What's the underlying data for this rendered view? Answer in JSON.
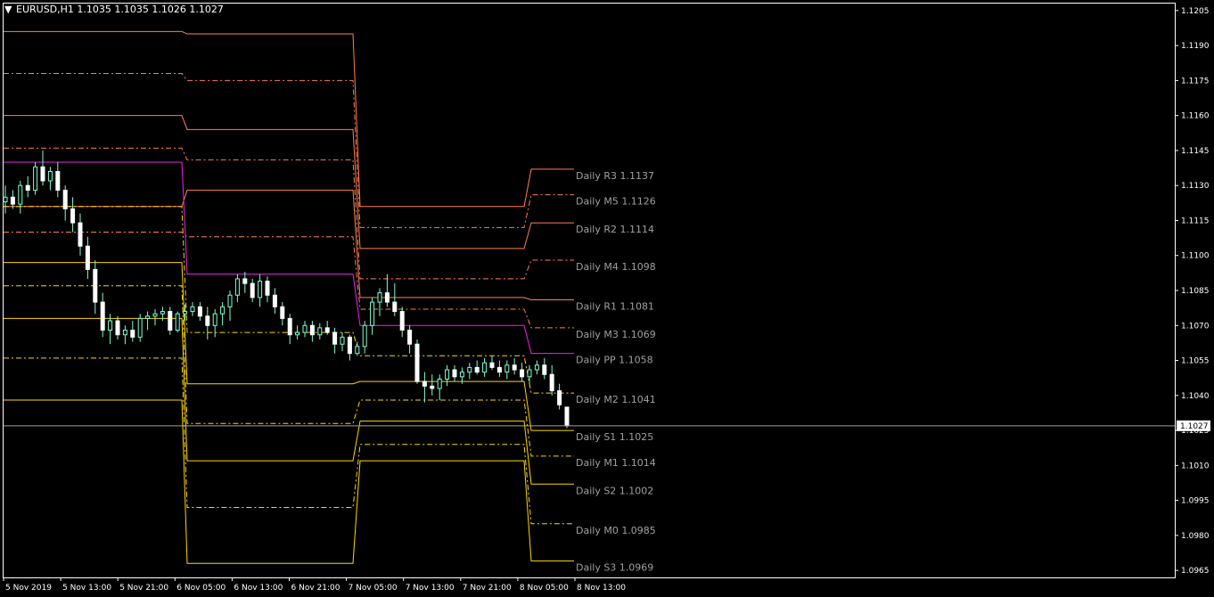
{
  "header": {
    "symbol_text": "EURUSD,H1  1.1035 1.1035 1.1026 1.1027",
    "dropdown_glyph": "▼"
  },
  "colors": {
    "background": "#000000",
    "axis": "#ffffff",
    "bull": "#7fffd4",
    "bear": "#ffffff",
    "wick": "#7fffd4",
    "resistance": "#ff7f50",
    "pivot": "#ee22ee",
    "support": "#ffd700",
    "mid": "#ffffff",
    "label": "#a0a0a0"
  },
  "chart_data": {
    "type": "candlestick",
    "symbol": "EURUSD",
    "timeframe": "H1",
    "last_price": 1.1027,
    "ylim": [
      1.0962,
      1.1208
    ],
    "y_ticks": [
      "1.1205",
      "1.1190",
      "1.1175",
      "1.1160",
      "1.1145",
      "1.1130",
      "1.1115",
      "1.1100",
      "1.1085",
      "1.1070",
      "1.1055",
      "1.1040",
      "1.1025",
      "1.1010",
      "1.0995",
      "1.0980",
      "1.0965"
    ],
    "x_ticks": [
      "5 Nov 2019",
      "5 Nov 13:00",
      "5 Nov 21:00",
      "6 Nov 05:00",
      "6 Nov 13:00",
      "6 Nov 21:00",
      "7 Nov 05:00",
      "7 Nov 13:00",
      "7 Nov 21:00",
      "8 Nov 05:00",
      "8 Nov 13:00"
    ],
    "current_price_label": "1.1027",
    "candles": [
      [
        1.1123,
        1.113,
        1.1118,
        1.1125
      ],
      [
        1.1125,
        1.1128,
        1.112,
        1.1122
      ],
      [
        1.1122,
        1.1132,
        1.1118,
        1.113
      ],
      [
        1.113,
        1.1134,
        1.1125,
        1.1128
      ],
      [
        1.1128,
        1.114,
        1.1126,
        1.1138
      ],
      [
        1.1138,
        1.1145,
        1.113,
        1.1132
      ],
      [
        1.1132,
        1.1138,
        1.1128,
        1.1136
      ],
      [
        1.1136,
        1.114,
        1.1125,
        1.1128
      ],
      [
        1.1128,
        1.113,
        1.1115,
        1.112
      ],
      [
        1.112,
        1.1125,
        1.111,
        1.1114
      ],
      [
        1.1114,
        1.1118,
        1.11,
        1.1104
      ],
      [
        1.1104,
        1.1108,
        1.109,
        1.1094
      ],
      [
        1.1094,
        1.1098,
        1.1075,
        1.108
      ],
      [
        1.108,
        1.1084,
        1.1065,
        1.1068
      ],
      [
        1.1068,
        1.1075,
        1.1062,
        1.1072
      ],
      [
        1.1072,
        1.1074,
        1.1064,
        1.1066
      ],
      [
        1.1066,
        1.107,
        1.1062,
        1.1068
      ],
      [
        1.1068,
        1.1072,
        1.1063,
        1.1065
      ],
      [
        1.1065,
        1.1075,
        1.1063,
        1.1073
      ],
      [
        1.1073,
        1.1076,
        1.1068,
        1.1074
      ],
      [
        1.1074,
        1.1077,
        1.107,
        1.1075
      ],
      [
        1.1075,
        1.1078,
        1.1072,
        1.1076
      ],
      [
        1.1076,
        1.1078,
        1.1066,
        1.1068
      ],
      [
        1.1068,
        1.1076,
        1.1067,
        1.1075
      ],
      [
        1.1075,
        1.1079,
        1.1072,
        1.1076
      ],
      [
        1.1076,
        1.108,
        1.1074,
        1.1078
      ],
      [
        1.1078,
        1.108,
        1.1072,
        1.1074
      ],
      [
        1.1074,
        1.1078,
        1.1064,
        1.107
      ],
      [
        1.107,
        1.1077,
        1.1065,
        1.1075
      ],
      [
        1.1075,
        1.108,
        1.107,
        1.1078
      ],
      [
        1.1078,
        1.1085,
        1.1072,
        1.1083
      ],
      [
        1.1083,
        1.1092,
        1.108,
        1.109
      ],
      [
        1.109,
        1.1093,
        1.1084,
        1.1088
      ],
      [
        1.1088,
        1.109,
        1.108,
        1.1082
      ],
      [
        1.1082,
        1.1092,
        1.1078,
        1.1089
      ],
      [
        1.1089,
        1.1091,
        1.108,
        1.1083
      ],
      [
        1.1083,
        1.1086,
        1.1075,
        1.1078
      ],
      [
        1.1078,
        1.108,
        1.107,
        1.1073
      ],
      [
        1.1073,
        1.1075,
        1.1062,
        1.1066
      ],
      [
        1.1066,
        1.107,
        1.1064,
        1.1067
      ],
      [
        1.1067,
        1.1072,
        1.1065,
        1.107
      ],
      [
        1.107,
        1.1072,
        1.1063,
        1.1066
      ],
      [
        1.1066,
        1.1071,
        1.1064,
        1.1069
      ],
      [
        1.1069,
        1.1072,
        1.1066,
        1.1067
      ],
      [
        1.1067,
        1.1069,
        1.1058,
        1.1062
      ],
      [
        1.1062,
        1.1067,
        1.1059,
        1.1065
      ],
      [
        1.1065,
        1.1066,
        1.1055,
        1.1058
      ],
      [
        1.1058,
        1.1063,
        1.1057,
        1.1061
      ],
      [
        1.1061,
        1.1072,
        1.1058,
        1.107
      ],
      [
        1.107,
        1.1082,
        1.1066,
        1.108
      ],
      [
        1.108,
        1.1086,
        1.1074,
        1.1084
      ],
      [
        1.1084,
        1.1092,
        1.1078,
        1.108
      ],
      [
        1.108,
        1.1088,
        1.1074,
        1.1076
      ],
      [
        1.1076,
        1.1078,
        1.1065,
        1.1068
      ],
      [
        1.1068,
        1.107,
        1.1058,
        1.1062
      ],
      [
        1.1062,
        1.1064,
        1.1045,
        1.1046
      ],
      [
        1.1046,
        1.105,
        1.1037,
        1.1044
      ],
      [
        1.1044,
        1.1049,
        1.104,
        1.1043
      ],
      [
        1.1043,
        1.1049,
        1.1038,
        1.1047
      ],
      [
        1.1047,
        1.1053,
        1.1044,
        1.1051
      ],
      [
        1.1051,
        1.1053,
        1.1046,
        1.1048
      ],
      [
        1.1048,
        1.1052,
        1.1045,
        1.105
      ],
      [
        1.105,
        1.1054,
        1.1047,
        1.1052
      ],
      [
        1.1052,
        1.1055,
        1.1049,
        1.105
      ],
      [
        1.105,
        1.1056,
        1.1048,
        1.1054
      ],
      [
        1.1054,
        1.1057,
        1.1051,
        1.1052
      ],
      [
        1.1052,
        1.1055,
        1.1048,
        1.105
      ],
      [
        1.105,
        1.1055,
        1.1047,
        1.1053
      ],
      [
        1.1053,
        1.1056,
        1.1049,
        1.1051
      ],
      [
        1.1051,
        1.1054,
        1.1046,
        1.1048
      ],
      [
        1.1048,
        1.1053,
        1.1045,
        1.1051
      ],
      [
        1.1051,
        1.1055,
        1.1049,
        1.1053
      ],
      [
        1.1053,
        1.1056,
        1.1047,
        1.1049
      ],
      [
        1.1049,
        1.1053,
        1.104,
        1.1042
      ],
      [
        1.1042,
        1.1045,
        1.1034,
        1.1036
      ],
      [
        1.1035,
        1.1035,
        1.1026,
        1.1027
      ]
    ],
    "pivot_levels": [
      {
        "name": "R3",
        "kind": "resistance",
        "dash": false,
        "values": [
          1.1196,
          1.1195,
          1.1121,
          1.1137
        ]
      },
      {
        "name": "M5",
        "kind": "resistance",
        "dash": true,
        "values": [
          1.1178,
          1.1175,
          1.1112,
          1.1126
        ]
      },
      {
        "name": "R2",
        "kind": "resistance",
        "dash": false,
        "values": [
          1.116,
          1.1154,
          1.1103,
          1.1114
        ]
      },
      {
        "name": "M4",
        "kind": "resistance",
        "dash": true,
        "values": [
          1.1146,
          1.1141,
          1.109,
          1.1098
        ]
      },
      {
        "name": "R1",
        "kind": "resistance",
        "dash": false,
        "values": [
          1.1121,
          1.1128,
          1.1082,
          1.1081
        ]
      },
      {
        "name": "M3",
        "kind": "resistance",
        "dash": true,
        "values": [
          1.111,
          1.1108,
          1.1077,
          1.1069
        ]
      },
      {
        "name": "PP",
        "kind": "pivot",
        "dash": false,
        "values": [
          1.114,
          1.1092,
          1.107,
          1.1058
        ]
      },
      {
        "name": "M2",
        "kind": "support",
        "dash": true,
        "values": [
          1.1121,
          1.1067,
          1.1057,
          1.1041
        ]
      },
      {
        "name": "S1",
        "kind": "support",
        "dash": false,
        "values": [
          1.1097,
          1.1045,
          1.1046,
          1.1025
        ]
      },
      {
        "name": "M1",
        "kind": "support",
        "dash": true,
        "values": [
          1.1087,
          1.1028,
          1.1038,
          1.1014
        ]
      },
      {
        "name": "S2",
        "kind": "support",
        "dash": false,
        "values": [
          1.1073,
          1.1012,
          1.1029,
          1.1002
        ]
      },
      {
        "name": "M0",
        "kind": "support",
        "dash": true,
        "values": [
          1.1056,
          1.0992,
          1.1019,
          1.0985
        ]
      },
      {
        "name": "S3",
        "kind": "support",
        "dash": false,
        "values": [
          1.1038,
          1.0968,
          1.1012,
          1.0969
        ]
      }
    ],
    "level_labels": [
      "Daily R3 1.1137",
      "Daily M5 1.1126",
      "Daily R2 1.1114",
      "Daily M4 1.1098",
      "Daily R1 1.1081",
      "Daily M3 1.1069",
      "Daily PP 1.1058",
      "Daily M2 1.1041",
      "Daily S1 1.1025",
      "Daily M1 1.1014",
      "Daily S2 1.1002",
      "Daily M0 1.0985",
      "Daily S3 1.0969"
    ]
  }
}
